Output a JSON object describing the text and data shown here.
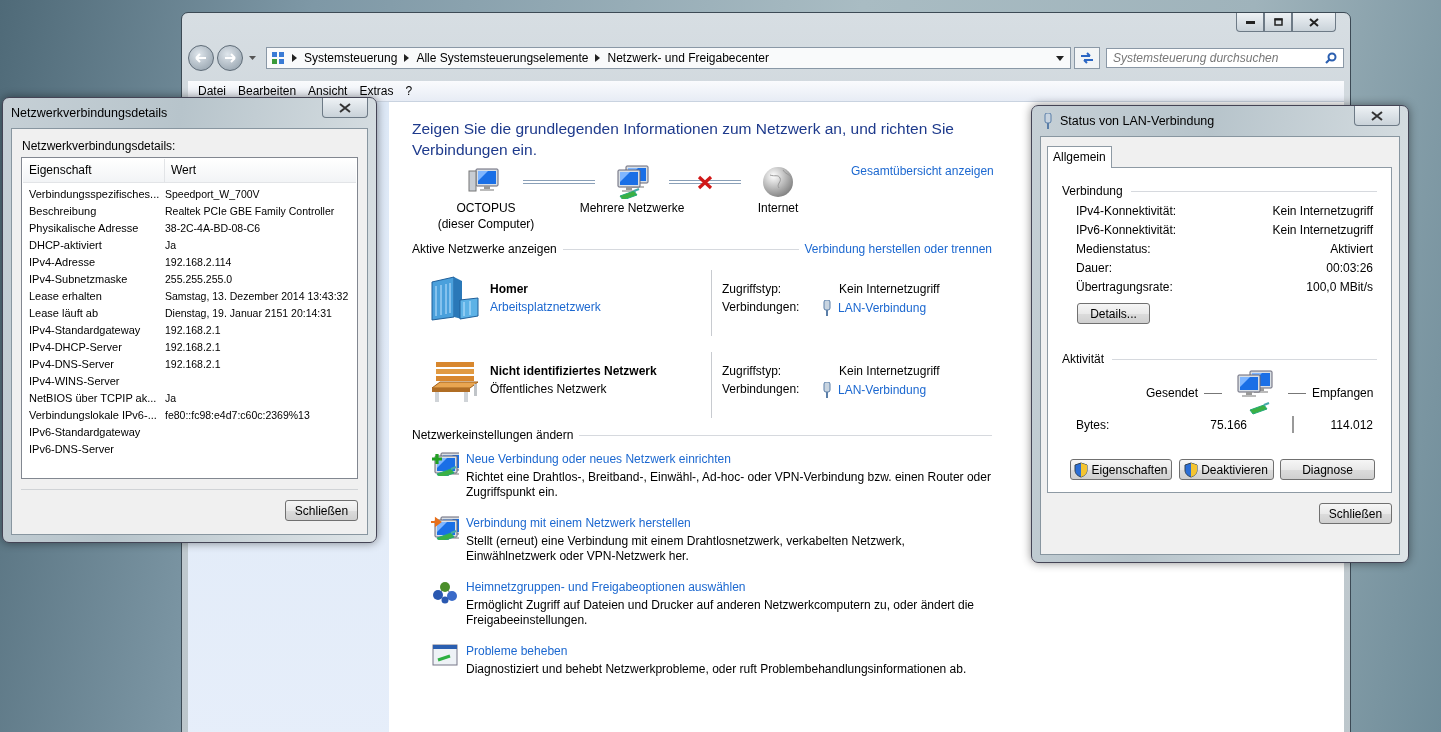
{
  "main_window": {
    "breadcrumb": [
      "Systemsteuerung",
      "Alle Systemsteuerungselemente",
      "Netzwerk- und Freigabecenter"
    ],
    "search": {
      "placeholder": "Systemsteuerung durchsuchen"
    },
    "menu": [
      "Datei",
      "Bearbeiten",
      "Ansicht",
      "Extras",
      "?"
    ]
  },
  "network_center": {
    "heading": "Zeigen Sie die grundlegenden Informationen zum Netzwerk an, und richten Sie Verbindungen ein.",
    "map": [
      {
        "kind": "computer",
        "label": "OCTOPUS",
        "sublabel": "(dieser Computer)"
      },
      {
        "kind": "network",
        "label": "Mehrere Netzwerke"
      },
      {
        "kind": "internet",
        "label": "Internet"
      }
    ],
    "map_links": [
      {
        "broken": false
      },
      {
        "broken": true
      }
    ],
    "overview_link": "Gesamtübersicht anzeigen",
    "active_heading": "Aktive Netzwerke anzeigen",
    "connect_link": "Verbindung herstellen oder trennen",
    "networks": [
      {
        "kind": "work",
        "name": "Homer",
        "type": "Arbeitsplatznetzwerk",
        "type_link": true,
        "access_label": "Zugriffstyp:",
        "access": "Kein Internetzugriff",
        "connections_label": "Verbindungen:",
        "connection": "LAN-Verbindung"
      },
      {
        "kind": "public",
        "name": "Nicht identifiziertes Netzwerk",
        "type": "Öffentliches Netzwerk",
        "type_link": false,
        "access_label": "Zugriffstyp:",
        "access": "Kein Internetzugriff",
        "connections_label": "Verbindungen:",
        "connection": "LAN-Verbindung"
      }
    ],
    "settings_heading": "Netzwerkeinstellungen ändern",
    "tasks": [
      {
        "kind": "new",
        "title": "Neue Verbindung oder neues Netzwerk einrichten",
        "description": "Richtet eine Drahtlos-, Breitband-, Einwähl-, Ad-hoc- oder VPN-Verbindung bzw. einen Router oder Zugriffspunkt ein."
      },
      {
        "kind": "connect",
        "title": "Verbindung mit einem Netzwerk herstellen",
        "description": "Stellt (erneut) eine Verbindung mit einem Drahtlosnetzwerk, verkabelten Netzwerk, Einwählnetzwerk oder VPN-Netzwerk her."
      },
      {
        "kind": "homegroup",
        "title": "Heimnetzgruppen- und Freigabeoptionen auswählen",
        "description": "Ermöglicht Zugriff auf Dateien und Drucker auf anderen Netzwerkcomputern zu, oder ändert die Freigabeeinstellungen."
      },
      {
        "kind": "troubleshoot",
        "title": "Probleme beheben",
        "description": "Diagnostiziert und behebt Netzwerkprobleme, oder ruft Problembehandlungsinformationen ab."
      }
    ]
  },
  "details_dialog": {
    "title": "Netzwerkverbindungsdetails",
    "label": "Netzwerkverbindungsdetails:",
    "columns": [
      "Eigenschaft",
      "Wert"
    ],
    "rows": [
      [
        "Verbindungsspezifisches...",
        "Speedport_W_700V"
      ],
      [
        "Beschreibung",
        "Realtek PCIe GBE Family Controller"
      ],
      [
        "Physikalische Adresse",
        "38-2C-4A-BD-08-C6"
      ],
      [
        "DHCP-aktiviert",
        "Ja"
      ],
      [
        "IPv4-Adresse",
        "192.168.2.114"
      ],
      [
        "IPv4-Subnetzmaske",
        "255.255.255.0"
      ],
      [
        "Lease erhalten",
        "Samstag, 13. Dezember 2014 13:43:32"
      ],
      [
        "Lease läuft ab",
        "Dienstag, 19. Januar 2151 20:14:31"
      ],
      [
        "IPv4-Standardgateway",
        "192.168.2.1"
      ],
      [
        "IPv4-DHCP-Server",
        "192.168.2.1"
      ],
      [
        "IPv4-DNS-Server",
        "192.168.2.1"
      ],
      [
        "IPv4-WINS-Server",
        ""
      ],
      [
        "NetBIOS über TCPIP ak...",
        "Ja"
      ],
      [
        "Verbindungslokale IPv6-...",
        "fe80::fc98:e4d7:c60c:2369%13"
      ],
      [
        "IPv6-Standardgateway",
        ""
      ],
      [
        "IPv6-DNS-Server",
        ""
      ]
    ],
    "close_button": "Schließen"
  },
  "status_dialog": {
    "title": "Status von LAN-Verbindung",
    "tabs": [
      {
        "label": "Allgemein",
        "selected": true
      }
    ],
    "connection_heading": "Verbindung",
    "connection_rows": [
      {
        "label": "IPv4-Konnektivität:",
        "value": "Kein Internetzugriff"
      },
      {
        "label": "IPv6-Konnektivität:",
        "value": "Kein Internetzugriff"
      },
      {
        "label": "Medienstatus:",
        "value": "Aktiviert"
      },
      {
        "label": "Dauer:",
        "value": "00:03:26"
      },
      {
        "label": "Übertragungsrate:",
        "value": "100,0 MBit/s"
      }
    ],
    "details_button": "Details...",
    "activity_heading": "Aktivität",
    "sent_label": "Gesendet",
    "received_label": "Empfangen",
    "bytes_label": "Bytes:",
    "bytes_sent": "75.166",
    "bytes_received": "114.012",
    "buttons": [
      {
        "label": "Eigenschaften",
        "shield": true
      },
      {
        "label": "Deaktivieren",
        "shield": true
      },
      {
        "label": "Diagnose",
        "shield": false
      }
    ],
    "close_button": "Schließen"
  }
}
